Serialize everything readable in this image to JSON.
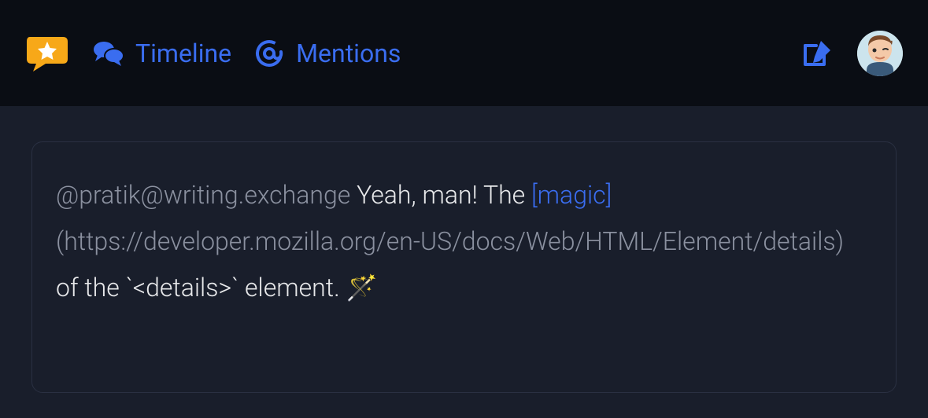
{
  "header": {
    "tabs": [
      {
        "label": "Timeline"
      },
      {
        "label": "Mentions"
      }
    ]
  },
  "compose": {
    "mention": "@pratik@writing.exchange",
    "text_before_link": " Yeah, man! The ",
    "link_text": "[magic]",
    "url_text": "(https://developer.mozilla.org/en-US/docs/Web/HTML/Element/details)",
    "text_after_url": " of the `<details>` element. 🪄"
  }
}
